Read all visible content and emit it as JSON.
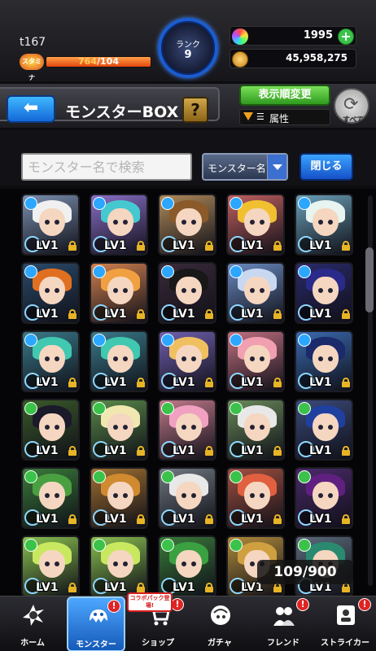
{
  "player": {
    "name": "t167",
    "stamina_label": "スタミナ",
    "stamina_current": "764",
    "stamina_max": "104",
    "stamina_fill_percent": 100
  },
  "rank": {
    "label": "ランク",
    "value": "9"
  },
  "currency": {
    "orbs": "1995",
    "coins": "45,958,275"
  },
  "title_bar": {
    "title": "モンスターBOX",
    "help_label": "?",
    "sort_label": "表示順変更",
    "filter_label": "属性",
    "all_label": "すべて"
  },
  "search": {
    "placeholder": "モンスター名で検索",
    "type_label": "モンスター名",
    "close_label": "閉じる"
  },
  "monsters": {
    "level_label": "LV1",
    "count": "109/900",
    "cells": [
      {
        "bg": "#7a8fb0",
        "hair": "#f0f0f0",
        "element": "#2ba7ff"
      },
      {
        "bg": "#8a6fc8",
        "hair": "#45c8d0",
        "element": "#2ba7ff"
      },
      {
        "bg": "#b08a5a",
        "hair": "#8a5a2a",
        "element": "#2ba7ff"
      },
      {
        "bg": "#c06060",
        "hair": "#f0c030",
        "element": "#2ba7ff"
      },
      {
        "bg": "#6aa0b8",
        "hair": "#e8f4f0",
        "element": "#2ba7ff"
      },
      {
        "bg": "#2a4a6a",
        "hair": "#e07020",
        "element": "#2ba7ff"
      },
      {
        "bg": "#d08050",
        "hair": "#f0a040",
        "element": "#2ba7ff"
      },
      {
        "bg": "#3a2a3a",
        "hair": "#181818",
        "element": "#2ba7ff"
      },
      {
        "bg": "#6a8ac0",
        "hair": "#c8d8f0",
        "element": "#2ba7ff"
      },
      {
        "bg": "#2a2a6a",
        "hair": "#2a2a8a",
        "element": "#2ba7ff"
      },
      {
        "bg": "#3a7a8a",
        "hair": "#40c8b0",
        "element": "#2ba7ff"
      },
      {
        "bg": "#3a7a8a",
        "hair": "#40c8b0",
        "element": "#2ba7ff"
      },
      {
        "bg": "#7060b0",
        "hair": "#f0c060",
        "element": "#2ba7ff"
      },
      {
        "bg": "#c07080",
        "hair": "#f0a0b0",
        "element": "#2ba7ff"
      },
      {
        "bg": "#3a6ab0",
        "hair": "#1a2a6a",
        "element": "#2ba7ff"
      },
      {
        "bg": "#3a5a2a",
        "hair": "#1a1a2a",
        "element": "#3ac24a"
      },
      {
        "bg": "#5a8a4a",
        "hair": "#f0e8b0",
        "element": "#3ac24a"
      },
      {
        "bg": "#c07a8a",
        "hair": "#f0a0c0",
        "element": "#3ac24a"
      },
      {
        "bg": "#6a8a5a",
        "hair": "#e8e8e8",
        "element": "#3ac24a"
      },
      {
        "bg": "#3a4a7a",
        "hair": "#2040a0",
        "element": "#3ac24a"
      },
      {
        "bg": "#3a7a3a",
        "hair": "#4aa040",
        "element": "#3ac24a"
      },
      {
        "bg": "#a07030",
        "hair": "#d08a30",
        "element": "#3ac24a"
      },
      {
        "bg": "#707880",
        "hair": "#e8e8e8",
        "element": "#3ac24a"
      },
      {
        "bg": "#a05040",
        "hair": "#e06040",
        "element": "#3ac24a"
      },
      {
        "bg": "#4a2a6a",
        "hair": "#602080",
        "element": "#3ac24a"
      },
      {
        "bg": "#8ac050",
        "hair": "#c8e860",
        "element": "#3ac24a"
      },
      {
        "bg": "#8ac050",
        "hair": "#c8e860",
        "element": "#3ac24a"
      },
      {
        "bg": "#3a7a3a",
        "hair": "#3aa040",
        "element": "#3ac24a"
      },
      {
        "bg": "#b08a3a",
        "hair": "#d0a040",
        "element": "#3ac24a"
      },
      {
        "bg": "#5a6a7a",
        "hair": "#2a8a70",
        "element": "#3ac24a"
      }
    ]
  },
  "nav": {
    "home": "ホーム",
    "monster": "モンスター",
    "shop": "ショップ",
    "gacha": "ガチャ",
    "friend": "フレンド",
    "striker": "ストライカー",
    "alert": "!",
    "collab_badge": "コラボパック登場!"
  }
}
